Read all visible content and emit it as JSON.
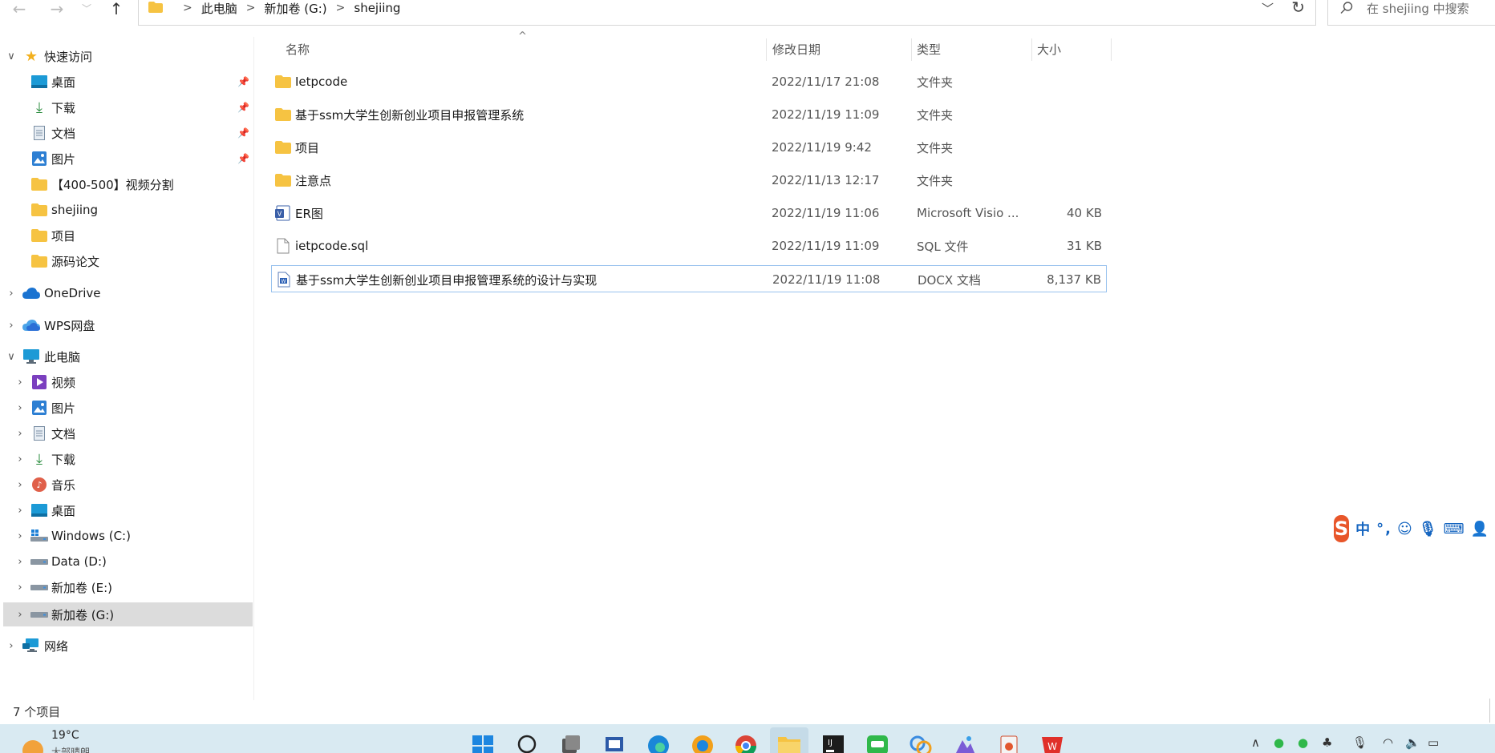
{
  "address": {
    "crumbs": [
      "此电脑",
      "新加卷 (G:)",
      "shejiing"
    ]
  },
  "search": {
    "placeholder": "在 shejiing 中搜索"
  },
  "sidebar": {
    "quick_access": "快速访问",
    "quick_items": [
      "桌面",
      "下载",
      "文档",
      "图片",
      "【400-500】视频分割",
      "shejiing",
      "项目",
      "源码论文"
    ],
    "onedrive": "OneDrive",
    "wps": "WPS网盘",
    "this_pc": "此电脑",
    "pc_items": [
      "视频",
      "图片",
      "文档",
      "下载",
      "音乐",
      "桌面",
      "Windows (C:)",
      "Data (D:)",
      "新加卷 (E:)",
      "新加卷 (G:)"
    ],
    "network": "网络"
  },
  "columns": {
    "name": "名称",
    "date": "修改日期",
    "type": "类型",
    "size": "大小"
  },
  "files": [
    {
      "name": "Ietpcode",
      "date": "2022/11/17 21:08",
      "type": "文件夹",
      "size": "",
      "icon": "folder-icon"
    },
    {
      "name": "基于ssm大学生创新创业项目申报管理系统",
      "date": "2022/11/19 11:09",
      "type": "文件夹",
      "size": "",
      "icon": "folder-icon"
    },
    {
      "name": "项目",
      "date": "2022/11/19 9:42",
      "type": "文件夹",
      "size": "",
      "icon": "folder-icon"
    },
    {
      "name": "注意点",
      "date": "2022/11/13 12:17",
      "type": "文件夹",
      "size": "",
      "icon": "folder-icon"
    },
    {
      "name": "ER图",
      "date": "2022/11/19 11:06",
      "type": "Microsoft Visio ...",
      "size": "40 KB",
      "icon": "visio-icon"
    },
    {
      "name": "ietpcode.sql",
      "date": "2022/11/19 11:09",
      "type": "SQL 文件",
      "size": "31 KB",
      "icon": "file-icon"
    },
    {
      "name": "基于ssm大学生创新创业项目申报管理系统的设计与实现",
      "date": "2022/11/19 11:08",
      "type": "DOCX 文档",
      "size": "8,137 KB",
      "icon": "docx-icon"
    }
  ],
  "status": {
    "count": "7 个项目"
  },
  "ime": {
    "logo": "S",
    "mode": "中"
  },
  "taskbar": {
    "temp": "19°C",
    "weather_desc": "大部晴朗"
  },
  "colors": {
    "folder": "#f6c342",
    "selection": "#dcdcdc",
    "row_selected_border": "#99c2ee",
    "taskbar": "#d9eaf2"
  }
}
